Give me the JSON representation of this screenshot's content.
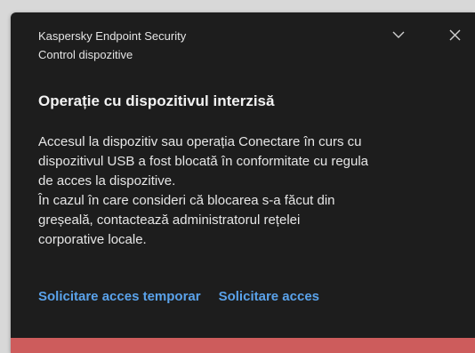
{
  "header": {
    "app_name": "Kaspersky Endpoint Security",
    "component": "Control dispozitive"
  },
  "window_controls": {
    "collapse_icon": "chevron-down-icon",
    "close_icon": "close-icon"
  },
  "notification": {
    "title": "Operație cu dispozitivul interzisă",
    "message_lines": [
      "Accesul la dispozitiv sau operația Conectare în curs cu",
      "dispozitivul USB a fost blocată în conformitate cu regula",
      "de acces la dispozitive.",
      "În cazul în care consideri că blocarea s-a făcut din",
      "greșeală, contactează administratorul rețelei",
      "corporative locale."
    ]
  },
  "actions": {
    "temporary_access_label": "Solicitare acces temporar",
    "access_label": "Solicitare acces"
  },
  "colors": {
    "background": "#1d1d1d",
    "text": "#e6e6e6",
    "link": "#5aa2ea",
    "status_bar": "#cd5c5c"
  }
}
